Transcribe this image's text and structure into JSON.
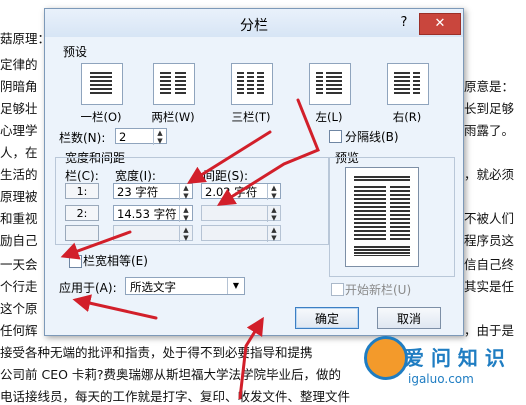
{
  "document": {
    "lines": [
      "菇原理：",
      "定律的",
      "阴暗角",
      "足够壮",
      "心理学",
      "人，在",
      "生活的",
      "原理被",
      "和重视",
      "励自己",
      "一天会",
      "个行走",
      "这个原",
      "任何辉",
      "接受各种无端的批评和指责，处于得不到必要指导和提携",
      "公司前 CEO 卡莉?费奥瑞娜从斯坦福大学法学院毕业后，做的",
      "电话接线员，每天的工作就是打字、复印、收发文件、整理文件"
    ],
    "right_lines": [
      "原意是：",
      "长到足够",
      "雨露了。",
      "，就必须",
      "不被人们",
      "程序员这",
      "信自己终",
      "其实是任",
      "，由于是"
    ]
  },
  "dialog": {
    "title": "分栏",
    "help": "?",
    "close": "✕",
    "presets_label": "预设",
    "presets": [
      "一栏(O)",
      "两栏(W)",
      "三栏(T)",
      "左(L)",
      "右(R)"
    ],
    "columns_label": "栏数(N):",
    "columns_value": "2",
    "divider_label": "分隔线(B)",
    "width_spacing_label": "宽度和间距",
    "col_header": "栏(C):",
    "width_header": "宽度(I):",
    "spacing_header": "间距(S):",
    "rows": [
      {
        "num": "1:",
        "width": "23 字符",
        "spacing": "2.02 字符"
      },
      {
        "num": "2:",
        "width": "14.53 字符",
        "spacing": ""
      },
      {
        "num": "",
        "width": "",
        "spacing": ""
      }
    ],
    "preview_label": "预览",
    "equal_width_label": "栏宽相等(E)",
    "apply_label": "应用于(A):",
    "apply_value": "所选文字",
    "new_column_label": "开始新栏(U)",
    "ok": "确定",
    "cancel": "取消"
  },
  "watermark": {
    "text": "爱 问 知 识",
    "url": "igaluo.com"
  },
  "colors": {
    "accent": "#4a7bb7",
    "arrow": "#d21f2a",
    "close": "#c9463d"
  }
}
